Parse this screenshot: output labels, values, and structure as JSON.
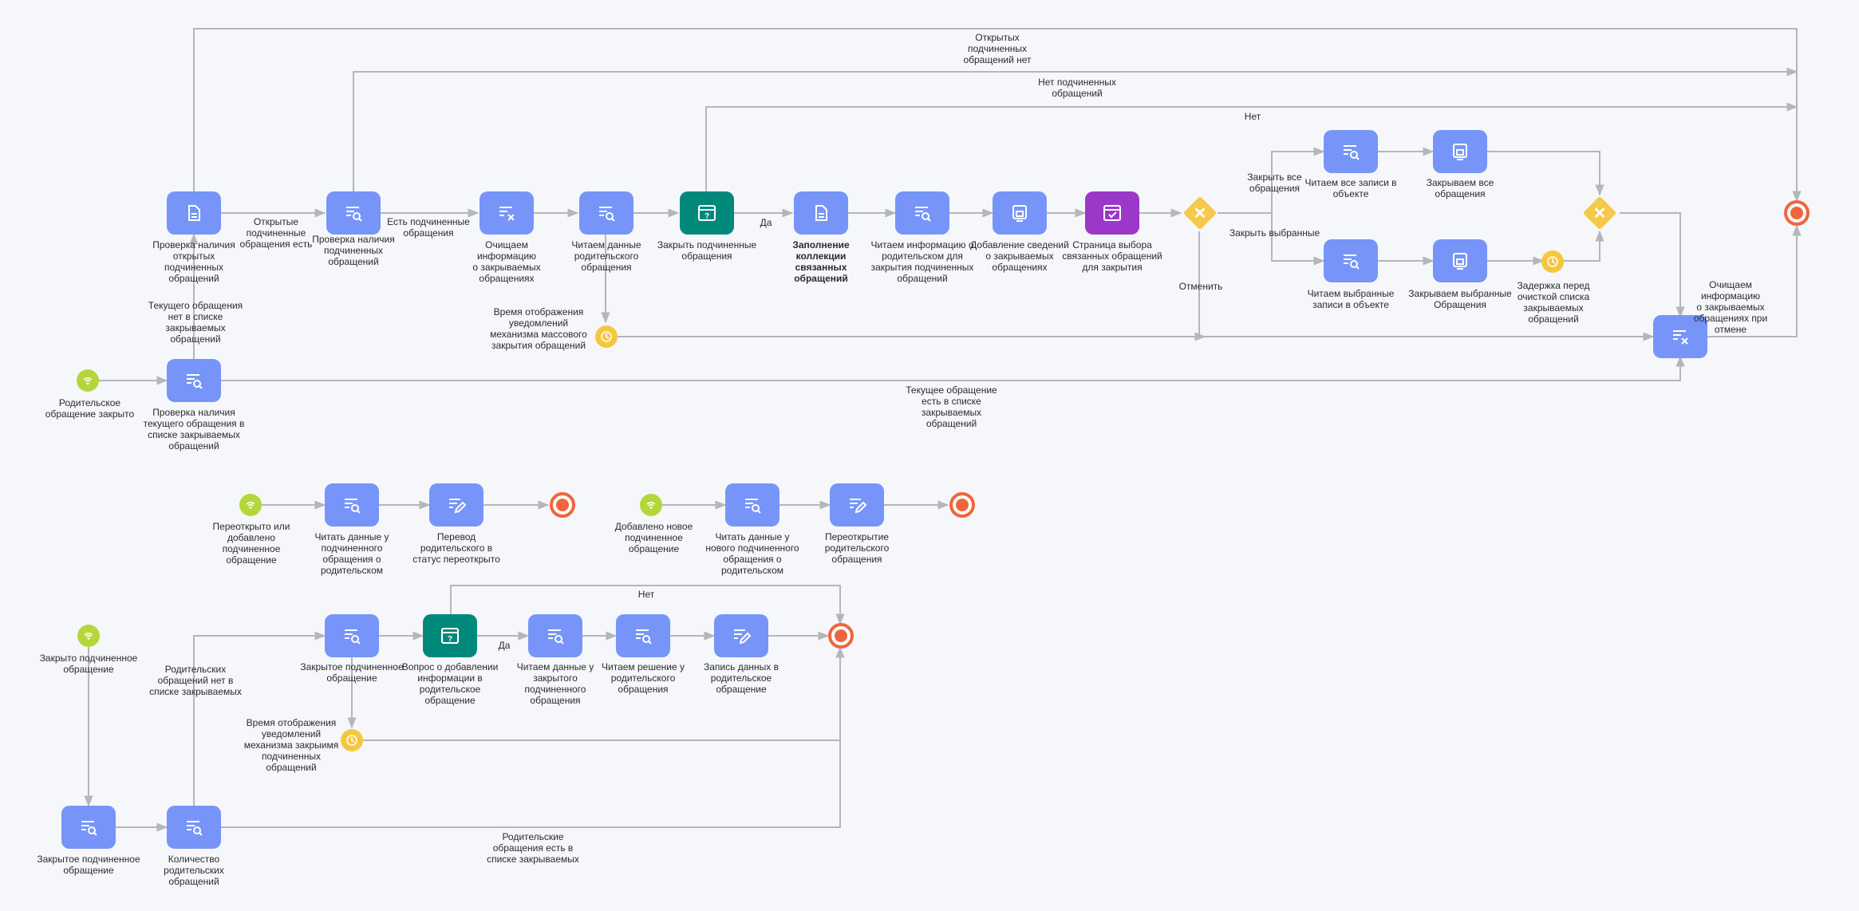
{
  "nodes": {
    "n1": "Проверка наличия\nоткрытых\nподчиненных\nобращений",
    "n2": "Проверка наличия\nподчиненных\nобращений",
    "n3": "Очищаем информацию\nо закрываемых\nобращениях",
    "n4": "Читаем данные\nродительского\nобращения",
    "n5": "Закрыть подчиненные\nобращения",
    "n6": "Заполнение коллекции\nсвязанных обращений",
    "n7": "Читаем информацию о\nродительском для\nзакрытия подчиненных\nобращений",
    "n8": "Добавление сведений\nо закрываемых\nобращениях",
    "n9": "Страница выбора\nсвязанных обращений\nдля закрытия",
    "n10": "Читаем все записи в\nобъекте",
    "n11": "Закрываем все\nобращения",
    "n12": "Читаем выбранные\nзаписи в объекте",
    "n13": "Закрываем выбранные\nОбращения",
    "n14": "Очищаем информацию\nо закрываемых\nобращениях при\nотмене",
    "n15": "Проверка наличия\nтекущего обращения в\nсписке закрываемых\nобращений",
    "s1": "Родительское\nобращение закрыто",
    "t1": "Время отображения\nуведомлений\nмеханизма массового\nзакрытия обращений",
    "t2": "Задержка перед\nочисткой списка\nзакрываемых\nобращений",
    "s2": "Переоткрыто или\nдобавлено\nподчиненное\nобращение",
    "n16": "Читать данные у\nподчиненного\nобращения о\nродительском",
    "n17": "Перевод\nродительского в\nстатус переоткрыто",
    "s3": "Добавлено новое\nподчиненное\nобращение",
    "n18": "Читать данные у\nнового подчиненного\nобращения о\nродительском",
    "n19": "Переоткрытие\nродительского\nобращения",
    "s4": "Закрыто подчиненное\nобращение",
    "n20": "Закрытое подчиненное\nобращение",
    "n21": "Вопрос о добавлении\nинформации в\nродительское\nобращение",
    "n22": "Читаем данные у\nзакрытого\nподчиненного\nобращения",
    "n23": "Читаем решение у\nродительского\nобращения",
    "n24": "Запись данных в\nродительское\nобращение",
    "t3": "Время отображения\nуведомлений\nмеханизма закрыимя\nподчиненных\nобращений",
    "n25": "Закрытое подчиненное\nобращение",
    "n26": "Количество\nродительских\nобращений"
  },
  "edges": {
    "e1": "Открытых\nподчиненных\nобращений нет",
    "e2": "Нет подчиненных\nобращений",
    "e3": "Нет",
    "e4": "Открытые\nподчиненные\nобращения есть",
    "e5": "Есть подчиненные\nобращения",
    "e6": "Да",
    "e7": "Закрыть все\nобращения",
    "e8": "Закрыть выбранные",
    "e9": "Отменить",
    "e10": "Текущего обращения\nнет в списке\nзакрываемых\nобращений",
    "e11": "Текущее обращение\nесть в списке\nзакрываемых\nобращений",
    "e12": "Нет",
    "e13": "Да",
    "e14": "Родительских\nобращений нет в\nсписке закрываемых",
    "e15": "Родительские\nобращения есть в\nсписке закрываемых"
  },
  "colors": {
    "task": "#7795f8",
    "question": "#00897b",
    "page": "#9b38c9",
    "start_event": "#b5d63a",
    "timer_event": "#f6c63f",
    "end_event": "#f0653e",
    "gateway": "#f6c94a",
    "connector": "#b4b6bb"
  }
}
